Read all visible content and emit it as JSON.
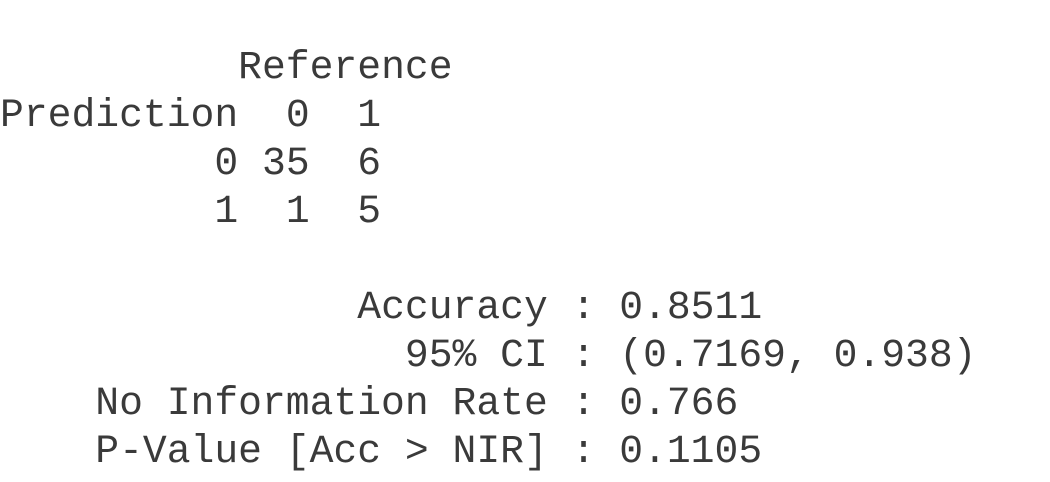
{
  "confusion_matrix": {
    "reference_header": "Reference",
    "prediction_label": "Prediction",
    "column_labels": [
      "0",
      "1"
    ],
    "rows": [
      {
        "label": "0",
        "cells": [
          "35",
          "6"
        ]
      },
      {
        "label": "1",
        "cells": [
          "1",
          "5"
        ]
      }
    ]
  },
  "statistics": [
    {
      "name": "Accuracy",
      "value": "0.8511"
    },
    {
      "name": "95% CI",
      "value": "(0.7169, 0.938)"
    },
    {
      "name": "No Information Rate",
      "value": "0.766"
    },
    {
      "name": "P-Value [Acc > NIR]",
      "value": "0.1105"
    }
  ]
}
